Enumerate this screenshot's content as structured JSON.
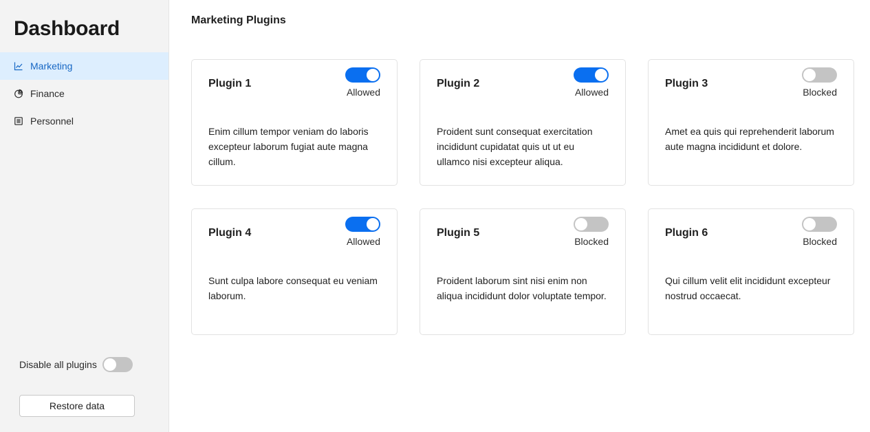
{
  "sidebar": {
    "title": "Dashboard",
    "items": [
      {
        "label": "Marketing",
        "icon": "line-chart-icon",
        "active": true
      },
      {
        "label": "Finance",
        "icon": "pie-chart-icon",
        "active": false
      },
      {
        "label": "Personnel",
        "icon": "list-document-icon",
        "active": false
      }
    ],
    "disable_all_label": "Disable all plugins",
    "disable_all_on": false,
    "restore_label": "Restore data"
  },
  "main": {
    "title": "Marketing Plugins",
    "plugins": [
      {
        "name": "Plugin 1",
        "status": "Allowed",
        "enabled": true,
        "description": "Enim cillum tempor veniam do laboris excepteur laborum fugiat aute magna cillum."
      },
      {
        "name": "Plugin 2",
        "status": "Allowed",
        "enabled": true,
        "description": "Proident sunt consequat exercitation incididunt cupidatat quis ut ut eu ullamco nisi excepteur aliqua."
      },
      {
        "name": "Plugin 3",
        "status": "Blocked",
        "enabled": false,
        "description": "Amet ea quis qui reprehenderit laborum aute magna incididunt et dolore."
      },
      {
        "name": "Plugin 4",
        "status": "Allowed",
        "enabled": true,
        "description": "Sunt culpa labore consequat eu veniam laborum."
      },
      {
        "name": "Plugin 5",
        "status": "Blocked",
        "enabled": false,
        "description": "Proident laborum sint nisi enim non aliqua incididunt dolor voluptate tempor."
      },
      {
        "name": "Plugin 6",
        "status": "Blocked",
        "enabled": false,
        "description": "Qui cillum velit elit incididunt excepteur nostrud occaecat."
      }
    ]
  },
  "colors": {
    "accent": "#0a6ff0",
    "active_nav_bg": "#ddeefe",
    "active_nav_text": "#1767c4",
    "toggle_off": "#c4c4c4",
    "sidebar_bg": "#f3f3f3"
  }
}
